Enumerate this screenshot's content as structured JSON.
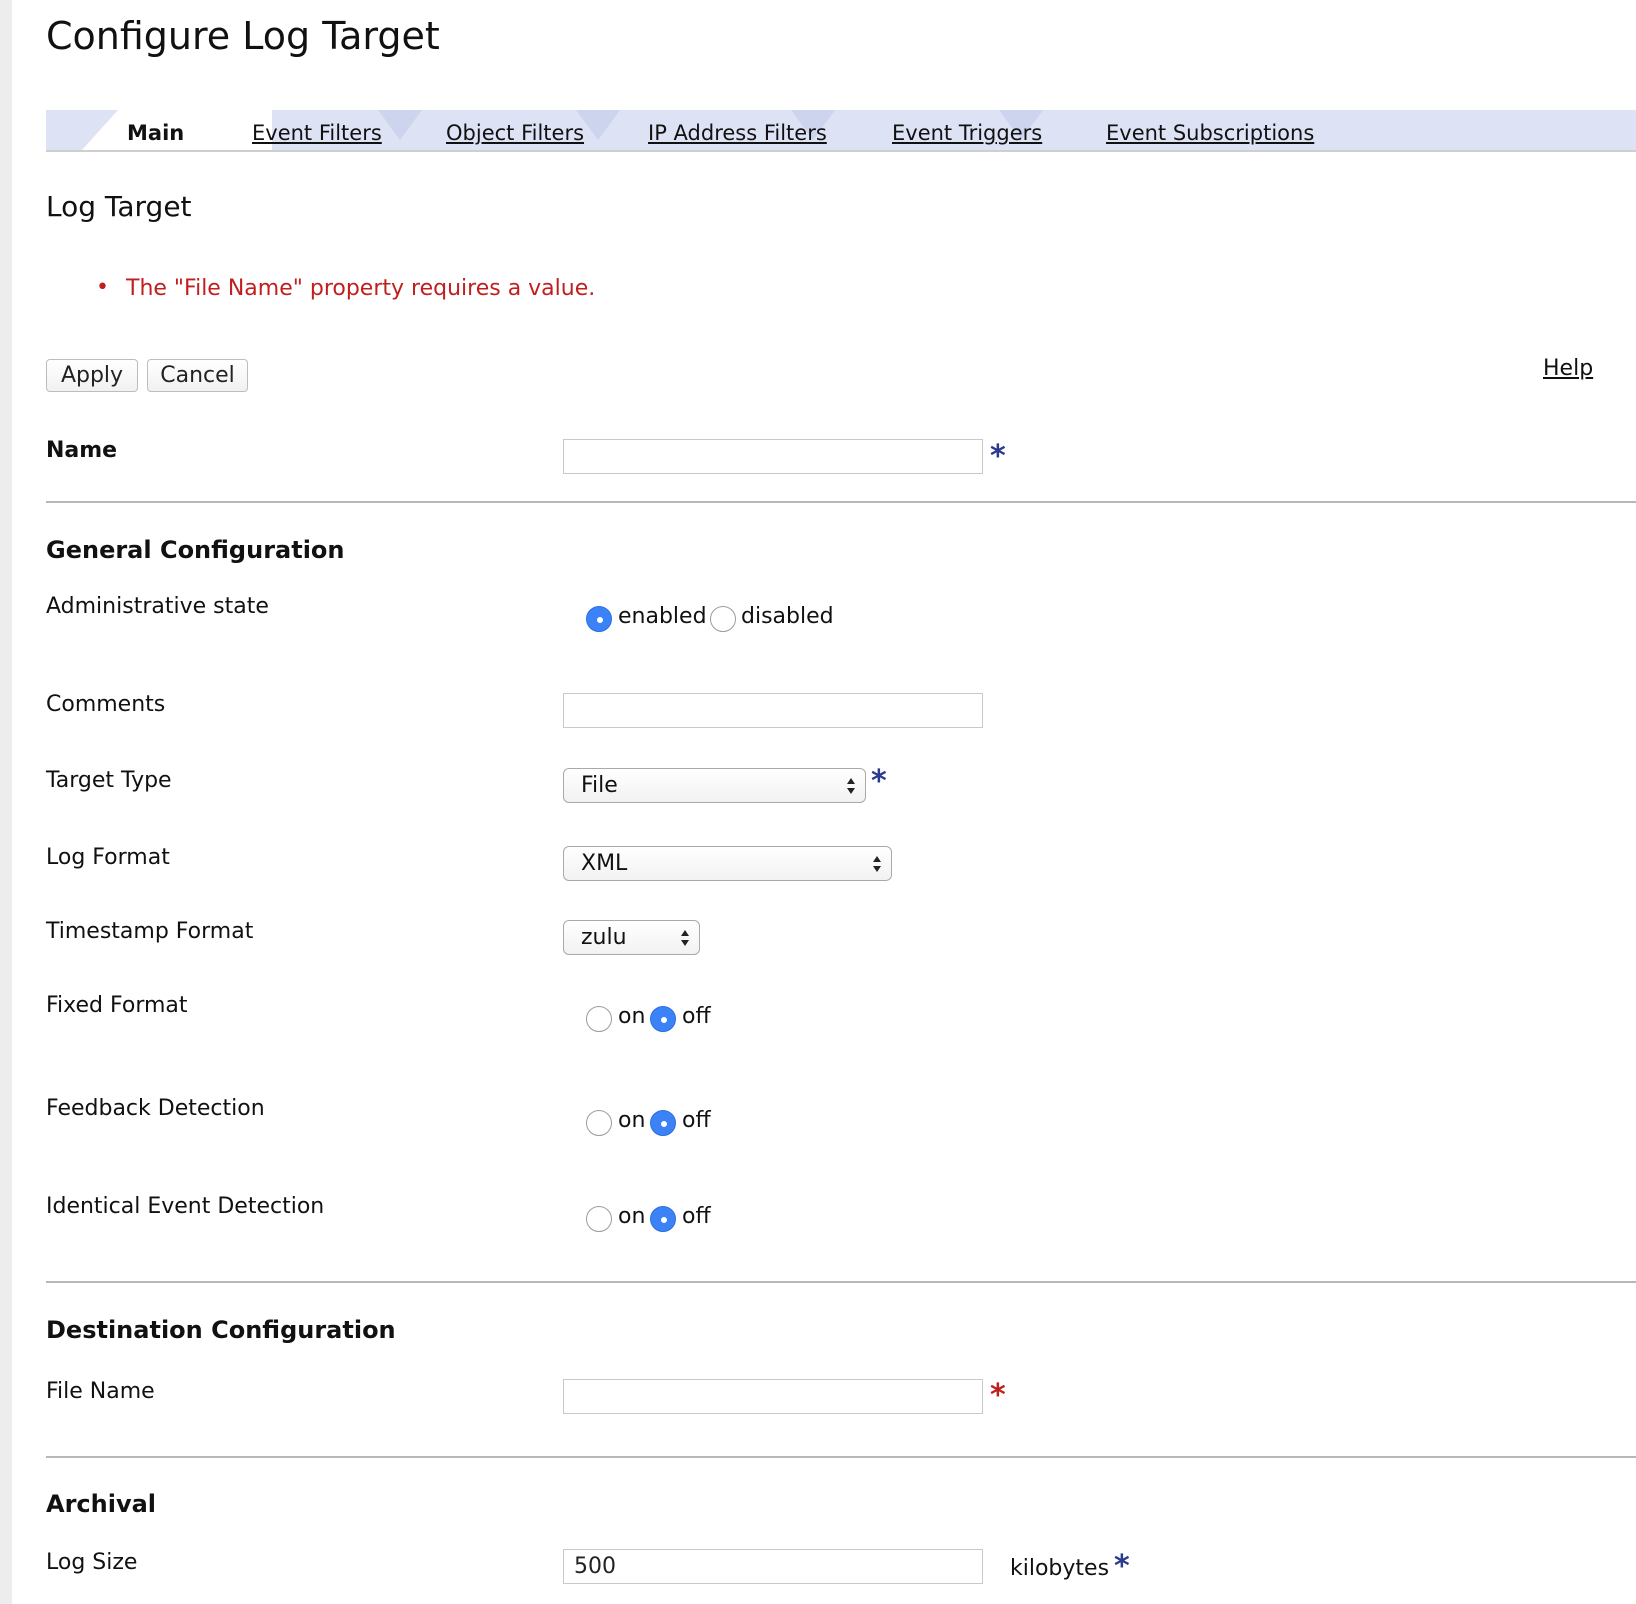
{
  "page": {
    "title": "Configure Log Target"
  },
  "tabs": [
    {
      "label": "Main",
      "active": true
    },
    {
      "label": "Event Filters",
      "active": false
    },
    {
      "label": "Object Filters",
      "active": false
    },
    {
      "label": "IP Address Filters",
      "active": false
    },
    {
      "label": "Event Triggers",
      "active": false
    },
    {
      "label": "Event Subscriptions",
      "active": false
    }
  ],
  "section": {
    "title": "Log Target"
  },
  "errors": [
    "The \"File Name\" property requires a value."
  ],
  "toolbar": {
    "apply_label": "Apply",
    "cancel_label": "Cancel",
    "help_label": "Help"
  },
  "name_field": {
    "label": "Name",
    "value": "",
    "required": true
  },
  "general": {
    "title": "General Configuration",
    "admin_state": {
      "label": "Administrative state",
      "options": [
        "enabled",
        "disabled"
      ],
      "selected": "enabled"
    },
    "comments": {
      "label": "Comments",
      "value": ""
    },
    "target_type": {
      "label": "Target Type",
      "value": "File",
      "required": true
    },
    "log_format": {
      "label": "Log Format",
      "value": "XML"
    },
    "timestamp_format": {
      "label": "Timestamp Format",
      "value": "zulu"
    },
    "fixed_format": {
      "label": "Fixed Format",
      "options": [
        "on",
        "off"
      ],
      "selected": "off"
    },
    "feedback_detection": {
      "label": "Feedback Detection",
      "options": [
        "on",
        "off"
      ],
      "selected": "off"
    },
    "identical_event_detection": {
      "label": "Identical Event Detection",
      "options": [
        "on",
        "off"
      ],
      "selected": "off"
    }
  },
  "destination": {
    "title": "Destination Configuration",
    "file_name": {
      "label": "File Name",
      "value": "",
      "required": true
    }
  },
  "archival": {
    "title": "Archival",
    "log_size": {
      "label": "Log Size",
      "value": "500",
      "unit": "kilobytes",
      "required": true
    }
  },
  "colors": {
    "tab_bar": "#dde3f5",
    "error": "#c01f1f",
    "required_asterisk": "#2b3a8c",
    "radio_selected": "#3b82f6"
  },
  "icons": {
    "required": "asterisk-icon",
    "select": "select-arrows-icon",
    "error_bullet": "bullet-icon"
  }
}
